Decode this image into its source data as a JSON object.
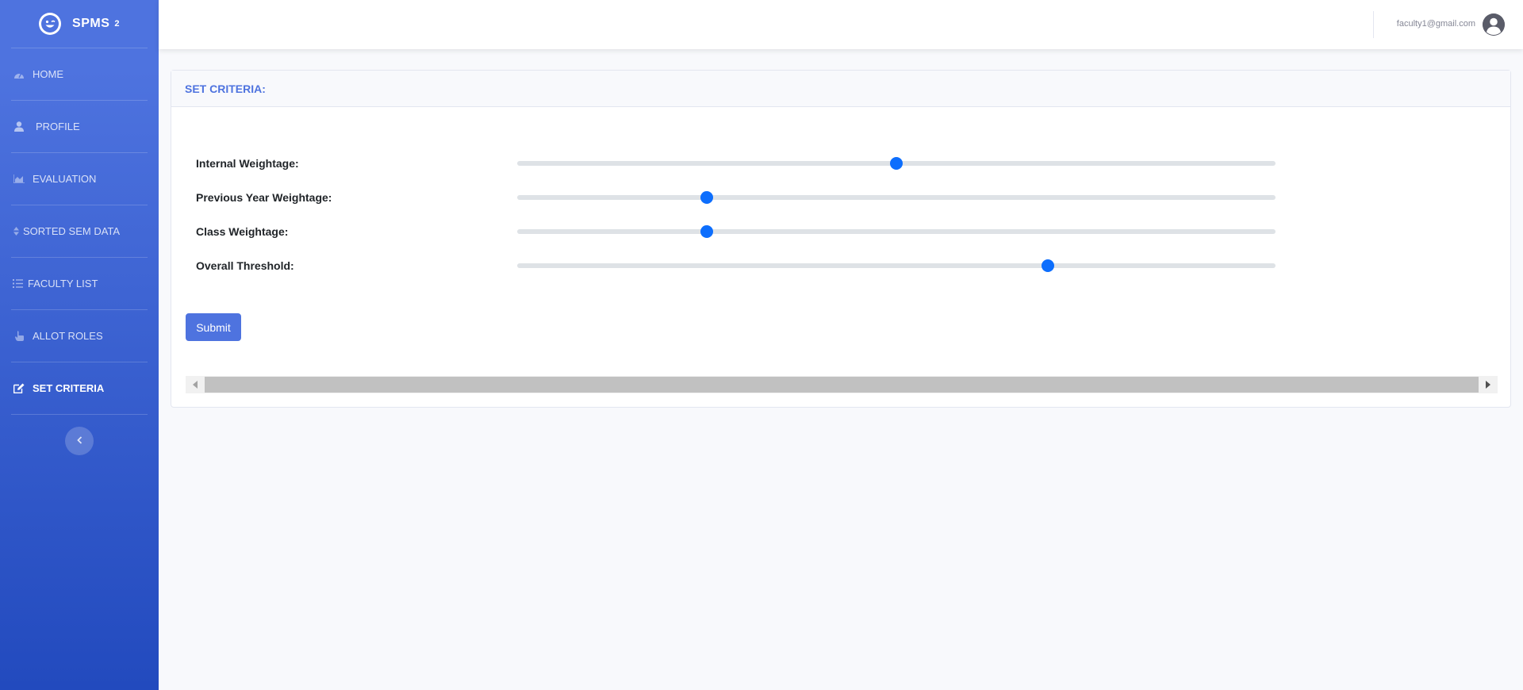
{
  "brand": {
    "name": "SPMS",
    "superscript": "2",
    "logo_icon": "grin-wink-icon"
  },
  "sidebar": {
    "items": [
      {
        "label": "HOME",
        "icon": "dashboard-icon",
        "active": false
      },
      {
        "label": "PROFILE",
        "icon": "user-icon",
        "active": false
      },
      {
        "label": "EVALUATION",
        "icon": "chart-area-icon",
        "active": false
      },
      {
        "label": "SORTED SEM DATA",
        "icon": "sort-icon",
        "active": false
      },
      {
        "label": "FACULTY LIST",
        "icon": "list-icon",
        "active": false
      },
      {
        "label": "ALLOT ROLES",
        "icon": "hand-pointer-icon",
        "active": false
      },
      {
        "label": "SET CRITERIA",
        "icon": "edit-icon",
        "active": true
      }
    ],
    "toggle_icon": "chevron-left-icon"
  },
  "topbar": {
    "user_email": "faculty1@gmail.com",
    "avatar_icon": "user-circle-icon"
  },
  "card": {
    "title": "SET CRITERIA:",
    "sliders": [
      {
        "label": "Internal Weightage:",
        "value_fraction": 0.5
      },
      {
        "label": "Previous Year Weightage:",
        "value_fraction": 0.25
      },
      {
        "label": "Class Weightage:",
        "value_fraction": 0.25
      },
      {
        "label": "Overall Threshold:",
        "value_fraction": 0.7
      }
    ],
    "submit_label": "Submit"
  },
  "colors": {
    "primary": "#4e73df",
    "slider_thumb": "#0d6efd",
    "sidebar_bottom": "#224abe"
  }
}
